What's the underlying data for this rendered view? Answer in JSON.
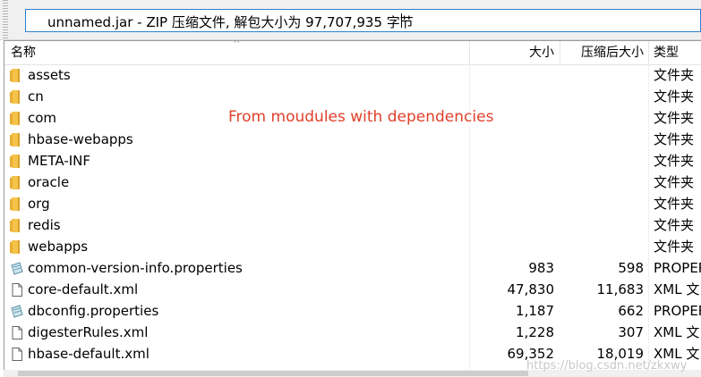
{
  "path_bar": {
    "text": "unnamed.jar - ZIP 压缩文件, 解包大小为 97,707,935 字节"
  },
  "columns": {
    "name": "名称",
    "size": "大小",
    "packed_size": "压缩后大小",
    "type": "类型"
  },
  "files": [
    {
      "name": "assets",
      "icon": "folder-icon",
      "size": "",
      "packed": "",
      "type": "文件夹"
    },
    {
      "name": "cn",
      "icon": "folder-icon",
      "size": "",
      "packed": "",
      "type": "文件夹"
    },
    {
      "name": "com",
      "icon": "folder-icon",
      "size": "",
      "packed": "",
      "type": "文件夹"
    },
    {
      "name": "hbase-webapps",
      "icon": "folder-icon",
      "size": "",
      "packed": "",
      "type": "文件夹"
    },
    {
      "name": "META-INF",
      "icon": "folder-icon",
      "size": "",
      "packed": "",
      "type": "文件夹"
    },
    {
      "name": "oracle",
      "icon": "folder-icon",
      "size": "",
      "packed": "",
      "type": "文件夹"
    },
    {
      "name": "org",
      "icon": "folder-icon",
      "size": "",
      "packed": "",
      "type": "文件夹"
    },
    {
      "name": "redis",
      "icon": "folder-icon",
      "size": "",
      "packed": "",
      "type": "文件夹"
    },
    {
      "name": "webapps",
      "icon": "folder-icon",
      "size": "",
      "packed": "",
      "type": "文件夹"
    },
    {
      "name": "common-version-info.properties",
      "icon": "properties-file-icon",
      "size": "983",
      "packed": "598",
      "type": "PROPER"
    },
    {
      "name": "core-default.xml",
      "icon": "document-file-icon",
      "size": "47,830",
      "packed": "11,683",
      "type": "XML 文"
    },
    {
      "name": "dbconfig.properties",
      "icon": "properties-file-icon",
      "size": "1,187",
      "packed": "662",
      "type": "PROPER"
    },
    {
      "name": "digesterRules.xml",
      "icon": "document-file-icon",
      "size": "1,228",
      "packed": "307",
      "type": "XML 文"
    },
    {
      "name": "hbase-default.xml",
      "icon": "document-file-icon",
      "size": "69,352",
      "packed": "18,019",
      "type": "XML 文"
    }
  ],
  "annotation": "From moudules with dependencies",
  "watermark": "https://blog.csdn.net/zkxwy",
  "colors": {
    "folder": "#f6c34a",
    "annotation": "#e0402a",
    "path_border": "#2f7fd0"
  }
}
